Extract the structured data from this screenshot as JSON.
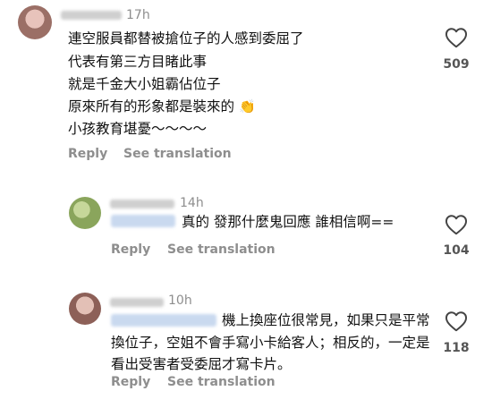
{
  "comments": [
    {
      "time": "17h",
      "lines": [
        "連空服員都替被搶位子的人感到委屈了",
        "代表有第三方目睹此事",
        "就是千金大小姐霸佔位子",
        "原來所有的形象都是裝來的",
        "小孩教育堪憂～～～～"
      ],
      "emoji": "👏",
      "likes": "509",
      "reply_label": "Reply",
      "translate_label": "See translation"
    },
    {
      "time": "14h",
      "lines": [
        "真的 發那什麼鬼回應 誰相信啊=="
      ],
      "likes": "104",
      "reply_label": "Reply",
      "translate_label": "See translation"
    },
    {
      "time": "10h",
      "lines": [
        "機上換座位很常見，如果只是平常",
        "換位子，空姐不會手寫小卡給客人；相反的，一定是",
        "看出受害者受委屈才寫卡片。"
      ],
      "likes": "118",
      "reply_label": "Reply",
      "translate_label": "See translation"
    }
  ],
  "icons": {
    "like": "heart-outline-icon",
    "clap": "clapping-hands-emoji"
  },
  "colors": {
    "muted": "#8e8e8e",
    "text": "#111111",
    "background": "#ffffff"
  }
}
